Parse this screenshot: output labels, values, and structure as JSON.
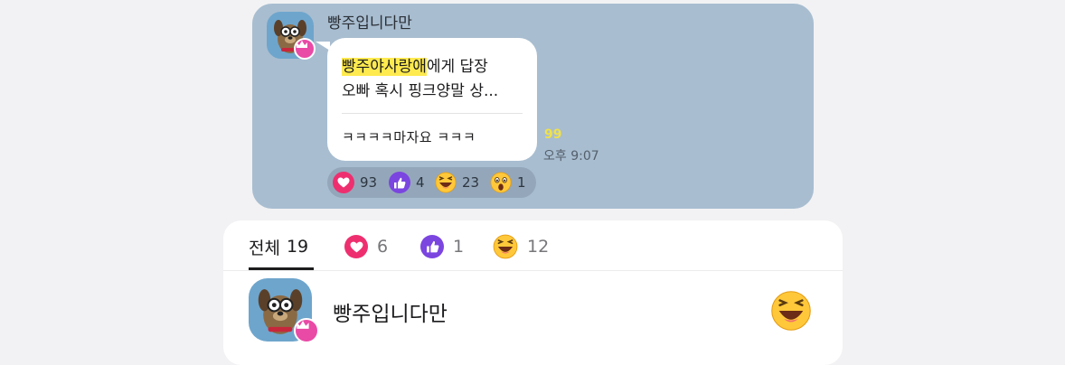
{
  "message": {
    "sender": "빵주입니다만",
    "reply_to_name": "빵주야사랑애",
    "reply_suffix": "에게 답장",
    "reply_preview": "오빠 혹시 핑크양말 상...",
    "text": "ㅋㅋㅋㅋ마자요 ㅋㅋㅋ",
    "read_count": "99",
    "time": "오후 9:07",
    "reactions": [
      {
        "type": "heart",
        "count": "93"
      },
      {
        "type": "thumbs-up",
        "count": "4"
      },
      {
        "type": "laughing",
        "count": "23"
      },
      {
        "type": "surprised",
        "count": "1"
      }
    ]
  },
  "reaction_panel": {
    "tabs": [
      {
        "label": "전체",
        "count": "19"
      },
      {
        "icon": "heart",
        "count": "6"
      },
      {
        "icon": "thumbs-up",
        "count": "1"
      },
      {
        "icon": "laughing",
        "count": "12"
      }
    ],
    "users": [
      {
        "name": "빵주입니다만",
        "reaction": "laughing"
      }
    ]
  },
  "colors": {
    "chat_background": "#a8bdd0",
    "bubble": "#ffffff",
    "reply_highlight": "#ffea4f",
    "heart": "#ee2f6f",
    "thumbs_up": "#7b45e0",
    "emoji_yellow": "#ffc83a",
    "crown_badge": "#e94aa6"
  }
}
